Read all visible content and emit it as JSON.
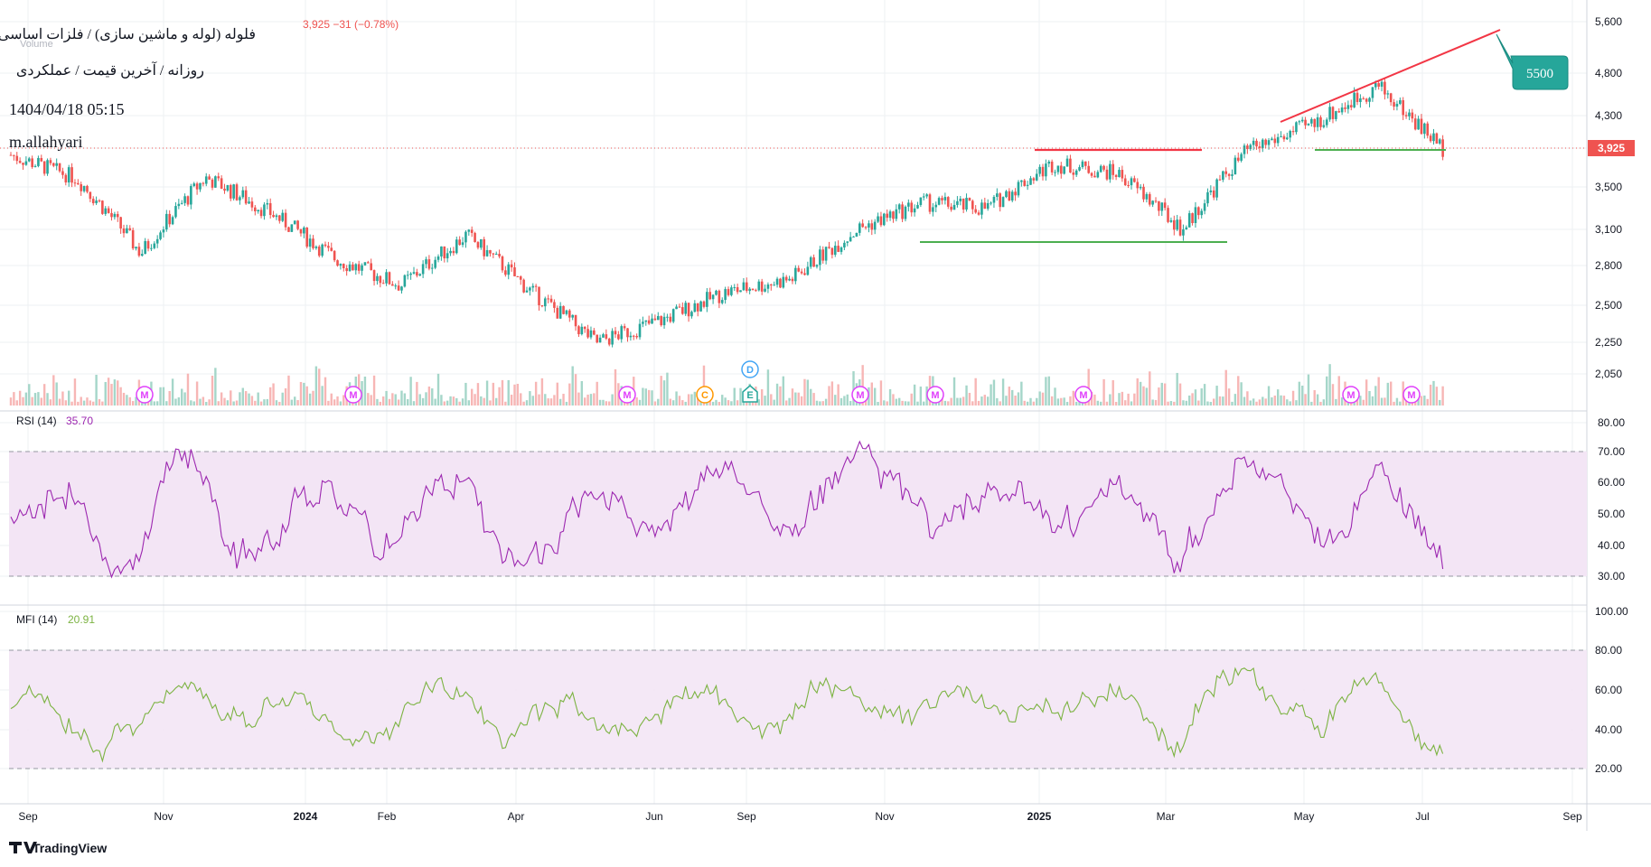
{
  "header": {
    "ohlc_strip": "3,925 −31 (−0.78%)",
    "volume_label": "Volume",
    "symbol_title": "فلوله (لوله و ماشین سازی) / فلزات اساسی",
    "subtitle": "روزانه / آخرین قیمت / عملکردی",
    "datetime": "1404/04/18 05:15",
    "author": "m.allahyari"
  },
  "price_axis": {
    "ticks": [
      "5,600",
      "4,800",
      "4,300",
      "3,925",
      "3,500",
      "3,100",
      "2,800",
      "2,500",
      "2,250",
      "2,050"
    ],
    "tick_values": [
      5600,
      4800,
      4300,
      3925,
      3500,
      3100,
      2800,
      2500,
      2250,
      2050
    ],
    "last_price_label": "3,925"
  },
  "rsi_panel": {
    "label": "RSI (14)",
    "value": "35.70",
    "ticks": [
      "80.00",
      "70.00",
      "60.00",
      "50.00",
      "40.00",
      "30.00"
    ]
  },
  "mfi_panel": {
    "label": "MFI (14)",
    "value": "20.91",
    "ticks": [
      "100.00",
      "80.00",
      "60.00",
      "40.00",
      "20.00"
    ]
  },
  "time_axis": {
    "labels": [
      "Sep",
      "Nov",
      "2024",
      "Feb",
      "Apr",
      "Jun",
      "Sep",
      "Nov",
      "2025",
      "Mar",
      "May",
      "Jul",
      "Sep"
    ]
  },
  "annotations": {
    "target_callout": "5500",
    "event_markers": [
      "M",
      "M",
      "M",
      "C",
      "D",
      "E",
      "M",
      "M",
      "M",
      "M",
      "M"
    ]
  },
  "branding": {
    "name": "TradingView"
  },
  "colors": {
    "up": "#26a69a",
    "down": "#ef5350",
    "rsi_line": "#9c27b0",
    "mfi_line": "#7cb342",
    "band_fill": "#f3e5f5",
    "trend_red": "#f23645",
    "support_green": "#4caf50",
    "callout": "#26a69a",
    "marker_pink": "#e040fb",
    "marker_orange": "#ff9800",
    "marker_blue": "#42a5f5"
  },
  "chart_data": {
    "type": "candlestick",
    "instrument": "فلوله",
    "last_price": 3925,
    "change": -31,
    "change_pct": -0.78,
    "anchors": [
      [
        "Sep 2023",
        3850
      ],
      [
        "Oct 2023",
        3600
      ],
      [
        "Nov 2023",
        2900
      ],
      [
        "Dec 2023",
        3600
      ],
      [
        "Jan 2024",
        3250
      ],
      [
        "Feb 2024",
        2850
      ],
      [
        "Mar 2024",
        2650
      ],
      [
        "Apr 2024",
        3050
      ],
      [
        "May 2024",
        2600
      ],
      [
        "Jun 2024",
        2250
      ],
      [
        "Jul 2024",
        2400
      ],
      [
        "Aug 2024",
        2600
      ],
      [
        "Sep 2024",
        2700
      ],
      [
        "Oct 2024",
        3100
      ],
      [
        "Nov 2024",
        3350
      ],
      [
        "Dec 2024",
        3300
      ],
      [
        "Jan 2025",
        3750
      ],
      [
        "Feb 2025",
        3650
      ],
      [
        "Mar 2025",
        3100
      ],
      [
        "Apr 2025",
        3900
      ],
      [
        "May 2025",
        4200
      ],
      [
        "Jun 2025",
        4650
      ],
      [
        "Jul 2025",
        3925
      ]
    ],
    "levels": {
      "resistance": 3950,
      "support_low": 3050,
      "support_high": 3925,
      "target": 5500
    },
    "rsi_bands": [
      30,
      70
    ],
    "mfi_bands": [
      20,
      80
    ],
    "rsi_last": 35.7,
    "mfi_last": 20.91
  }
}
